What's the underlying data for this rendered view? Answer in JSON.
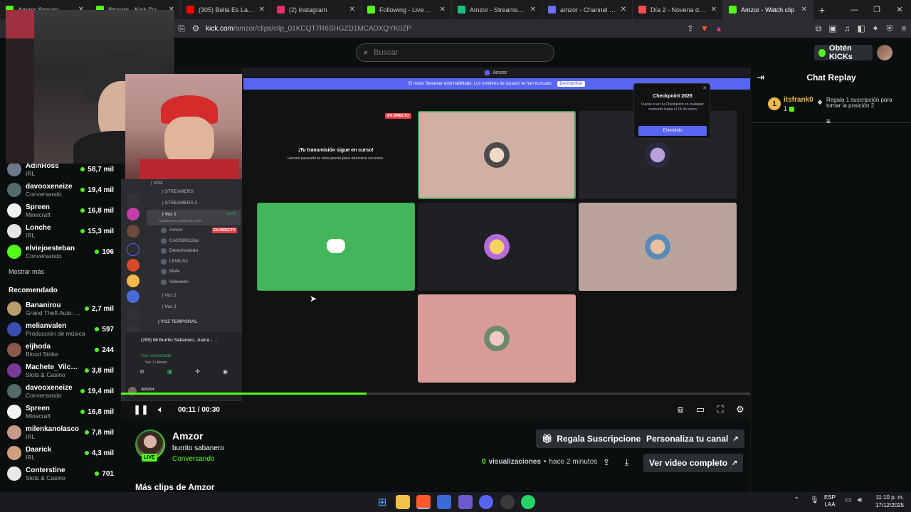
{
  "browser": {
    "tabs": [
      {
        "label": "Amzor Stream - Watch Li",
        "color": "#53fc18",
        "active": false
      },
      {
        "label": "Stream - Kick Dashbo",
        "color": "#53fc18",
        "active": false
      },
      {
        "label": "(305) Bella Es La Navidad",
        "color": "#ff0000",
        "active": false
      },
      {
        "label": "(2) Instagram",
        "color": "#e1306c",
        "active": false
      },
      {
        "label": "Following - Live Streams o",
        "color": "#53fc18",
        "active": false
      },
      {
        "label": "Amzor - Streams List and",
        "color": "#19c37d",
        "active": false
      },
      {
        "label": "amzor - Channel Streams",
        "color": "#6f6fff",
        "active": false
      },
      {
        "label": "Día 2 - Novena de Aguina",
        "color": "#ff4d4d",
        "active": false
      },
      {
        "label": "Amzor - Watch clip",
        "color": "#53fc18",
        "active": true
      }
    ],
    "url_host": "kick.com",
    "url_path": "/amzor/clips/clip_01KCQT7R6SHGZD1MCADXQYK0ZP"
  },
  "header": {
    "search_placeholder": "Buscar",
    "get_kicks_label": "Obtén KICKs"
  },
  "sidebar": {
    "following": [
      {
        "name": "AdinRoss",
        "category": "IRL",
        "viewers": "58,7 mil",
        "color": "#6b7a8c"
      },
      {
        "name": "davooxeneize",
        "category": "Conversando",
        "viewers": "19,4 mil",
        "color": "#556b6a"
      },
      {
        "name": "Spreen",
        "category": "Minecraft",
        "viewers": "16,8 mil",
        "color": "#f2f2f2"
      },
      {
        "name": "Lonche",
        "category": "IRL",
        "viewers": "15,3 mil",
        "color": "#e6e6e6"
      },
      {
        "name": "elviejoesteban",
        "category": "Conversando",
        "viewers": "106",
        "color": "#53fc18"
      }
    ],
    "show_more": "Mostrar más",
    "recommended_title": "Recomendado",
    "recommended": [
      {
        "name": "Bananirou",
        "category": "Grand Theft Auto: ...",
        "viewers": "2,7 mil",
        "color": "#b89c6c"
      },
      {
        "name": "melianvalen",
        "category": "Producción de música",
        "viewers": "597",
        "color": "#3a4fb0"
      },
      {
        "name": "eljhoda",
        "category": "Blood Strike",
        "viewers": "244",
        "color": "#8a5a4a"
      },
      {
        "name": "Machete_Vilches",
        "category": "Slots & Casino",
        "viewers": "3,8 mil",
        "color": "#7a3a9a"
      },
      {
        "name": "davooxeneize",
        "category": "Conversando",
        "viewers": "19,4 mil",
        "color": "#556b6a"
      },
      {
        "name": "Spreen",
        "category": "Minecraft",
        "viewers": "16,8 mil",
        "color": "#f2f2f2"
      },
      {
        "name": "milenkanolasco",
        "category": "IRL",
        "viewers": "7,8 mil",
        "color": "#c89a8a"
      },
      {
        "name": "Daarick",
        "category": "IRL",
        "viewers": "4,3 mil",
        "color": "#d0a080"
      },
      {
        "name": "Conterstine",
        "category": "Slots & Casino",
        "viewers": "701",
        "color": "#e8e8e8"
      }
    ]
  },
  "video": {
    "discord_window_title": "Amzor",
    "streamer_mode_text": "El modo Streamer está habilitado. Los nombres de usuario se han truncado.",
    "streamer_mode_button": "Deshabilitar",
    "live_badge": "EN DIRECTO",
    "paused_title": "¡Tu transmisión sigue en curso!",
    "paused_sub": "Hemos pausado la vista previa para ahorrarte recursos.",
    "checkpoint_title": "Checkpoint 2025",
    "checkpoint_body": "Vuelve a ver tu Checkpoint en cualquier momento hasta el 15 de enero",
    "checkpoint_button": "Entendido",
    "discord_channels": {
      "streamers_1": "| STREAMERS",
      "streamers_2": "| STREAMERS 2",
      "voice_1": "| Voz 1",
      "voice_1_time": "35:04",
      "voice_1_status": "Establece su estado de canal",
      "members": [
        "Amzor",
        "CAOSBK12xp",
        "Derechoviedo",
        "LEMUS2",
        "Mafe",
        "Valeeeen"
      ],
      "member_live": "EN DIRECTO",
      "voice_2": "| Voz 2",
      "voice_3": "| Voz 3",
      "voz_temporal": "| VOZ TEMPORAL",
      "voz_top": "| VOZ",
      "now_playing": "(299) Mi Burrito Sabanero, Juana - ...",
      "voice_connected": "Voz conectada",
      "voice_connected_sub": "Voz 1 / Amzor",
      "user": "Amzor"
    },
    "current_time": "00:11",
    "duration": "00:30",
    "progress": 0.39
  },
  "chat": {
    "title": "Chat Replay",
    "messages": [
      {
        "user": "itsfrank0",
        "rank": "1",
        "sub_count": "1",
        "text": "Regala 1 suscripción para tomar la posición 2"
      }
    ]
  },
  "info": {
    "streamer_name": "Amzor",
    "clip_title": "burrito sabanero",
    "category": "Conversando",
    "live_label": "LIVE",
    "gift_subs_button": "Regala Suscripciones",
    "customize_button": "Personaliza tu canal",
    "views_count": "0",
    "views_label": "visualizaciones",
    "time_ago": "hace 2 minutos",
    "full_video_button": "Ver video completo",
    "more_clips": "Más clips de Amzor"
  },
  "taskbar": {
    "lang_1": "ESP",
    "lang_2": "LAA",
    "time": "11:10 p. m.",
    "date": "17/12/2025"
  },
  "colors": {
    "kick_green": "#53fc18",
    "discord_blurple": "#5865f2",
    "bg": "#0b0e0f"
  }
}
